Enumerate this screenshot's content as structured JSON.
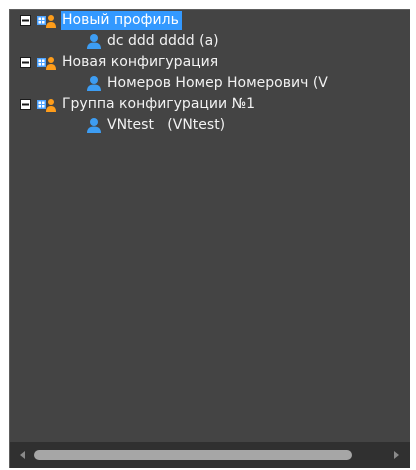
{
  "tree": {
    "nodes": [
      {
        "label": "Новый профиль",
        "type": "group",
        "expanded": true,
        "selected": true
      },
      {
        "label": "dc ddd dddd (a)",
        "type": "user"
      },
      {
        "label": "Новая конфигурация",
        "type": "group",
        "expanded": true
      },
      {
        "label": "Номеров Номер Номерович (V",
        "type": "user"
      },
      {
        "label": "Группа конфигурации №1",
        "type": "group",
        "expanded": true
      },
      {
        "label": "VNtest   (VNtest)",
        "type": "user"
      }
    ]
  },
  "colors": {
    "panel_background": "#444444",
    "selection": "#3399ff",
    "text": "#f2f2f2",
    "user_icon": "#3d9df3",
    "group_icon_orange": "#ff9d1a",
    "scrollbar_track": "#303030",
    "scrollbar_thumb": "#a6a6a6"
  }
}
